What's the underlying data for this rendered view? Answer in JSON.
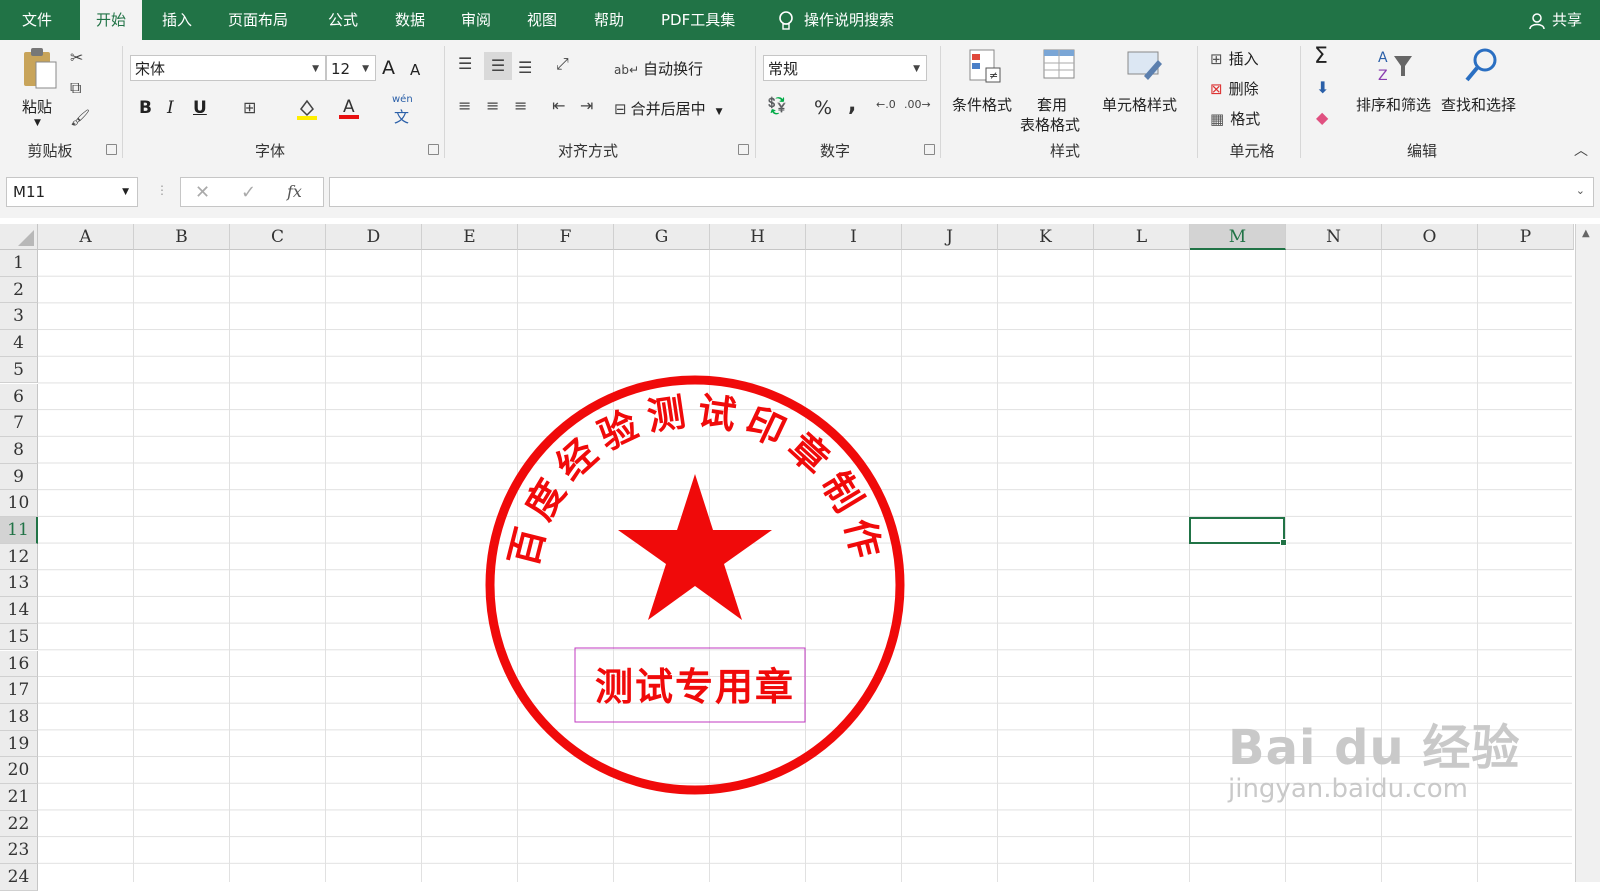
{
  "menu": {
    "tabs": [
      "文件",
      "开始",
      "插入",
      "页面布局",
      "公式",
      "数据",
      "审阅",
      "视图",
      "帮助",
      "PDF工具集"
    ],
    "search": "操作说明搜索",
    "share": "共享"
  },
  "ribbon": {
    "clipboard": {
      "paste": "粘贴",
      "label": "剪贴板"
    },
    "font": {
      "name": "宋体",
      "size": "12",
      "label": "字体",
      "bold": "B",
      "italic": "I",
      "underline": "U",
      "grow": "A",
      "shrink": "A",
      "phonetic_top": "wén",
      "phonetic_bottom": "文"
    },
    "alignment": {
      "wrap": "自动换行",
      "merge": "合并后居中",
      "label": "对齐方式"
    },
    "number": {
      "format": "常规",
      "percent": "%",
      "comma": ",",
      "label": "数字"
    },
    "styles": {
      "conditional": "条件格式",
      "table_top": "套用",
      "table_bottom": "表格格式",
      "cell_styles": "单元格样式",
      "label": "样式"
    },
    "cells": {
      "insert": "插入",
      "delete": "删除",
      "format": "格式",
      "label": "单元格"
    },
    "editing": {
      "sigma": "Σ",
      "sort": "排序和筛选",
      "find": "查找和选择",
      "label": "编辑"
    }
  },
  "formula_bar": {
    "name_box": "M11",
    "fx": "fx",
    "content": ""
  },
  "sheet": {
    "columns": [
      "A",
      "B",
      "C",
      "D",
      "E",
      "F",
      "G",
      "H",
      "I",
      "J",
      "K",
      "L",
      "M",
      "N",
      "O",
      "P"
    ],
    "rows": [
      "1",
      "2",
      "3",
      "4",
      "5",
      "6",
      "7",
      "8",
      "9",
      "10",
      "11",
      "12",
      "13",
      "14",
      "15",
      "16",
      "17",
      "18",
      "19",
      "20",
      "21",
      "22",
      "23",
      "24"
    ],
    "selected_cell": "M11"
  },
  "seal": {
    "arc_text": "百度经验测试印章制作",
    "bottom_text": "测试专用章",
    "color": "#f00a0a"
  },
  "watermark": {
    "logo": "Bai du 经验",
    "url": "jingyan.baidu.com"
  },
  "colors": {
    "excel_green": "#217346",
    "ribbon_bg": "#f3f3f3"
  }
}
